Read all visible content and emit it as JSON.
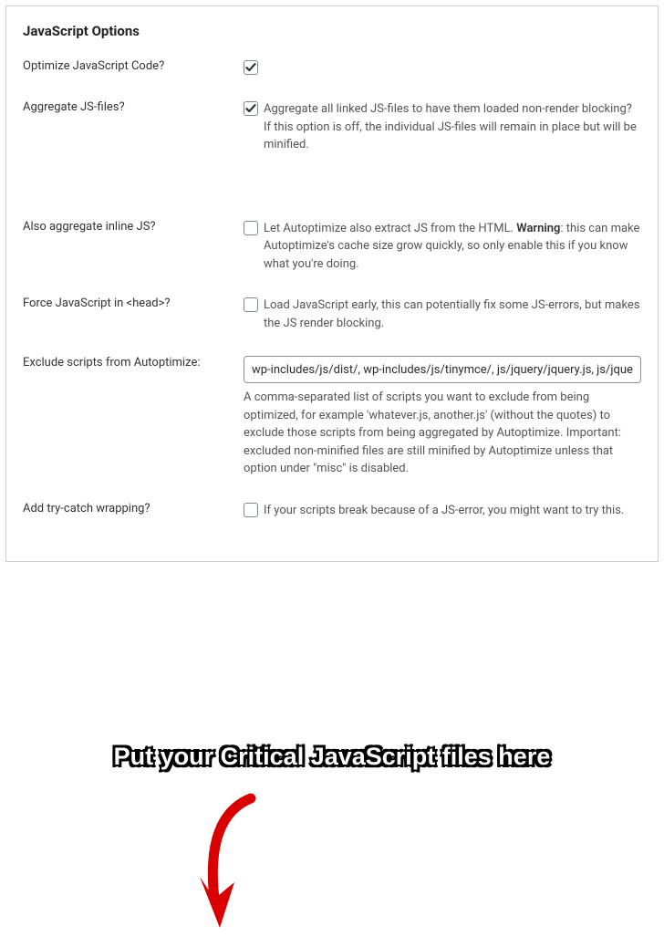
{
  "panel": {
    "title": "JavaScript Options"
  },
  "rows": {
    "optimize": {
      "label": "Optimize JavaScript Code?"
    },
    "aggregate": {
      "label": "Aggregate JS-files?",
      "desc": "Aggregate all linked JS-files to have them loaded non-render blocking? If this option is off, the individual JS-files will remain in place but will be minified."
    },
    "inline": {
      "label": "Also aggregate inline JS?",
      "desc_pre": "Let Autoptimize also extract JS from the HTML. ",
      "desc_warn": "Warning",
      "desc_post": ": this can make Autoptimize's cache size grow quickly, so only enable this if you know what you're doing."
    },
    "head": {
      "label": "Force JavaScript in <head>?",
      "desc": "Load JavaScript early, this can potentially fix some JS-errors, but makes the JS render blocking."
    },
    "exclude": {
      "label": "Exclude scripts from Autoptimize:",
      "value": "wp-includes/js/dist/, wp-includes/js/tinymce/, js/jquery/jquery.js, js/jquery/jquery-migrate.js",
      "help": "A comma-separated list of scripts you want to exclude from being optimized, for example 'whatever.js, another.js' (without the quotes) to exclude those scripts from being aggregated by Autoptimize. Important: excluded non-minified files are still minified by Autoptimize unless that option under \"misc\" is disabled."
    },
    "trycatch": {
      "label": "Add try-catch wrapping?",
      "desc": "If your scripts break because of a JS-error, you might want to try this."
    }
  },
  "callout": {
    "text": "Put your Critical JavaScript files here"
  }
}
